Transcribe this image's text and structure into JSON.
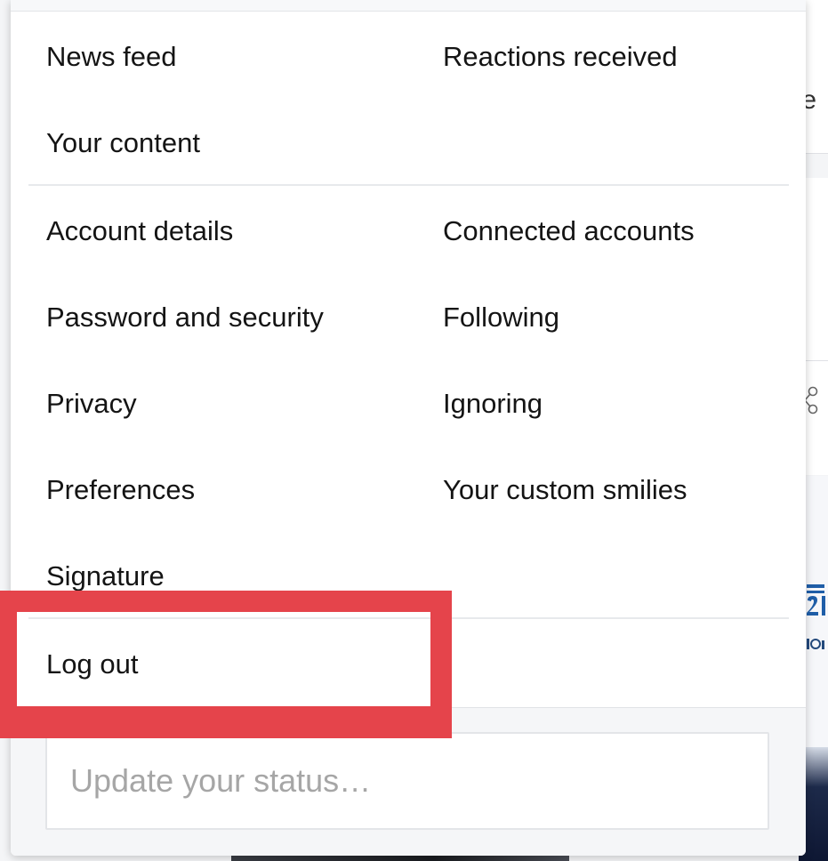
{
  "background": {
    "partial_text": "te"
  },
  "menu": {
    "links": {
      "news_feed": "News feed",
      "reactions_received": "Reactions received",
      "your_content": "Your content",
      "account_details": "Account details",
      "connected_accounts": "Connected accounts",
      "password_security": "Password and security",
      "following": "Following",
      "privacy": "Privacy",
      "ignoring": "Ignoring",
      "preferences": "Preferences",
      "custom_smilies": "Your custom smilies",
      "signature": "Signature",
      "log_out": "Log out"
    },
    "status": {
      "placeholder": "Update your status…",
      "value": ""
    }
  },
  "annotation": {
    "target": "Log out",
    "color": "#e5444b"
  },
  "colors": {
    "text": "#141414",
    "placeholder": "#a6a6a6",
    "divider": "#e7e9ec",
    "footer_bg": "#f5f6f8"
  }
}
